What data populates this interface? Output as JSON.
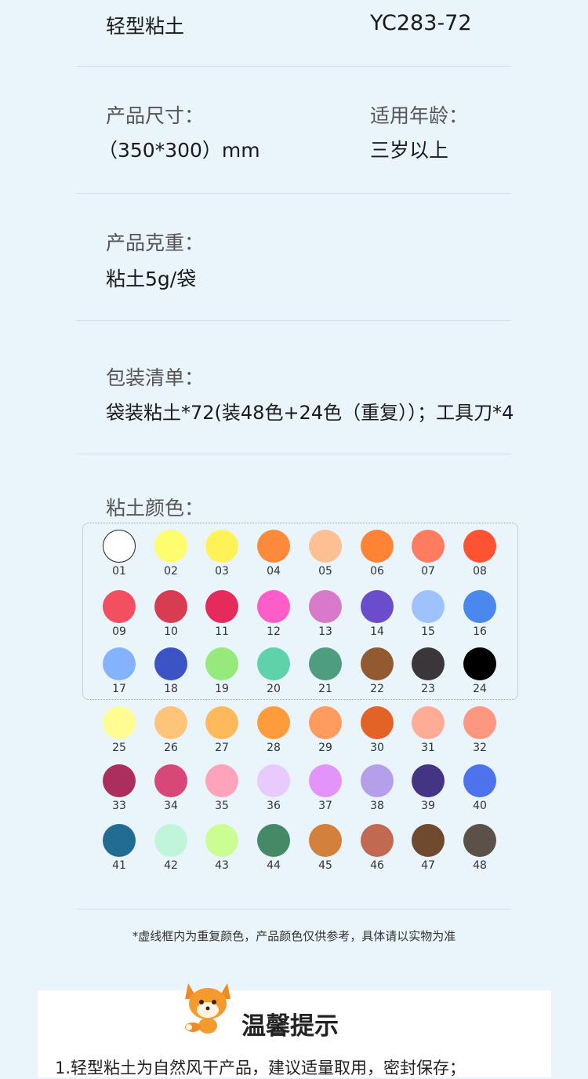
{
  "product": {
    "name_label": "轻型粘土",
    "model": "YC283-72",
    "size_label": "产品尺寸：",
    "size_value": "（350*300）mm",
    "age_label": "适用年龄：",
    "age_value": "三岁以上",
    "weight_label": "产品克重：",
    "weight_value": "粘土5g/袋",
    "package_label": "包装清单：",
    "package_value": "袋装粘土*72(装48色+24色（重复））；工具刀*4",
    "colors_label": "粘土颜色："
  },
  "swatches": [
    {
      "n": "01",
      "c": "#ffffff"
    },
    {
      "n": "02",
      "c": "#fdfd6e"
    },
    {
      "n": "03",
      "c": "#fef256"
    },
    {
      "n": "04",
      "c": "#fd8a3a"
    },
    {
      "n": "05",
      "c": "#fec092"
    },
    {
      "n": "06",
      "c": "#fd8435"
    },
    {
      "n": "07",
      "c": "#fe7d61"
    },
    {
      "n": "08",
      "c": "#fe5333"
    },
    {
      "n": "09",
      "c": "#f24f61"
    },
    {
      "n": "10",
      "c": "#d83c53"
    },
    {
      "n": "11",
      "c": "#e72a5c"
    },
    {
      "n": "12",
      "c": "#fd5dc8"
    },
    {
      "n": "13",
      "c": "#d979c9"
    },
    {
      "n": "14",
      "c": "#6b4ccb"
    },
    {
      "n": "15",
      "c": "#9ec3fc"
    },
    {
      "n": "16",
      "c": "#4a88ee"
    },
    {
      "n": "17",
      "c": "#85b2fd"
    },
    {
      "n": "18",
      "c": "#3b53c4"
    },
    {
      "n": "19",
      "c": "#95ea7b"
    },
    {
      "n": "20",
      "c": "#5fd1ab"
    },
    {
      "n": "21",
      "c": "#4e9d80"
    },
    {
      "n": "22",
      "c": "#915a30"
    },
    {
      "n": "23",
      "c": "#3b363a"
    },
    {
      "n": "24",
      "c": "#000000"
    },
    {
      "n": "25",
      "c": "#fefc93"
    },
    {
      "n": "26",
      "c": "#fec479"
    },
    {
      "n": "27",
      "c": "#feba5a"
    },
    {
      "n": "28",
      "c": "#fe9c3c"
    },
    {
      "n": "29",
      "c": "#fe9b5f"
    },
    {
      "n": "30",
      "c": "#e36326"
    },
    {
      "n": "31",
      "c": "#feac96"
    },
    {
      "n": "32",
      "c": "#fe9780"
    },
    {
      "n": "33",
      "c": "#ab2e5f"
    },
    {
      "n": "34",
      "c": "#d74879"
    },
    {
      "n": "35",
      "c": "#fea3ba"
    },
    {
      "n": "36",
      "c": "#e8cbfc"
    },
    {
      "n": "37",
      "c": "#e394fb"
    },
    {
      "n": "38",
      "c": "#b59feb"
    },
    {
      "n": "39",
      "c": "#443484"
    },
    {
      "n": "40",
      "c": "#4d73ec"
    },
    {
      "n": "41",
      "c": "#216c93"
    },
    {
      "n": "42",
      "c": "#c0f5da"
    },
    {
      "n": "43",
      "c": "#cafe92"
    },
    {
      "n": "44",
      "c": "#458a67"
    },
    {
      "n": "45",
      "c": "#d2803b"
    },
    {
      "n": "46",
      "c": "#c26a51"
    },
    {
      "n": "47",
      "c": "#6f4a2d"
    },
    {
      "n": "48",
      "c": "#5c5148"
    }
  ],
  "note": "*虚线框内为重复颜色，产品颜色仅供参考，具体请以实物为准",
  "tips": {
    "title": "温馨提示",
    "item_1": "1.轻型粘土为自然风干产品，建议适量取用，密封保存；"
  }
}
